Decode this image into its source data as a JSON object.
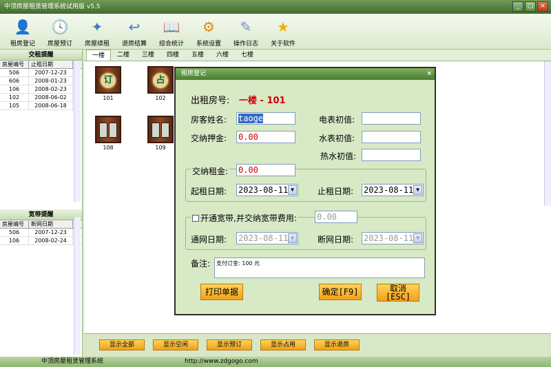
{
  "window": {
    "title": "中顶房屋租赁管理系统试用版 v5.5",
    "min": "_",
    "max": "□",
    "close": "×"
  },
  "toolbar": [
    {
      "label": "租房登记",
      "icon": "id-card-icon",
      "glyph": "👤",
      "color": "#3f7fc8"
    },
    {
      "label": "房屋预订",
      "icon": "calendar-clock-icon",
      "glyph": "🕓",
      "color": "#4a8fcf"
    },
    {
      "label": "房屋续租",
      "icon": "document-star-icon",
      "glyph": "✦",
      "color": "#3b7fbf"
    },
    {
      "label": "退房结算",
      "icon": "return-arrow-icon",
      "glyph": "↩",
      "color": "#3c7fcf"
    },
    {
      "label": "综合统计",
      "icon": "book-icon",
      "glyph": "📖",
      "color": "#d7a437"
    },
    {
      "label": "系统设置",
      "icon": "gear-icon",
      "glyph": "⚙",
      "color": "#e08a10"
    },
    {
      "label": "操作日志",
      "icon": "log-document-icon",
      "glyph": "✎",
      "color": "#6a8fbf"
    },
    {
      "label": "关于软件",
      "icon": "star-icon",
      "glyph": "★",
      "color": "#f0b000"
    }
  ],
  "rentReminder": {
    "title": "交租提醒",
    "col1": "房屋编号",
    "col2": "止租日期",
    "rows": [
      [
        "506",
        "2007-12-23"
      ],
      [
        "606",
        "2008-01-23"
      ],
      [
        "106",
        "2008-02-23"
      ],
      [
        "102",
        "2008-06-02"
      ],
      [
        "105",
        "2008-06-18"
      ]
    ]
  },
  "netReminder": {
    "title": "宽带提醒",
    "col1": "房屋编号",
    "col2": "断网日期",
    "rows": [
      [
        "506",
        "2007-12-23"
      ],
      [
        "106",
        "2008-02-24"
      ]
    ]
  },
  "floors": [
    "一楼",
    "二楼",
    "三楼",
    "四楼",
    "五楼",
    "六楼",
    "七楼"
  ],
  "rooms": [
    {
      "num": "101",
      "badge": "订"
    },
    {
      "num": "102",
      "badge": "占"
    },
    {
      "num": "108",
      "badge": ""
    },
    {
      "num": "109",
      "badge": ""
    }
  ],
  "bottomButtons": [
    "显示全部",
    "显示空闲",
    "显示预订",
    "显示占用",
    "显示退房"
  ],
  "status": {
    "left": "中顶房屋租赁管理系统",
    "url": "http://www.zdgogo.com"
  },
  "dialog": {
    "title": "租房登记",
    "close": "×",
    "roomLabel": "出租房号:",
    "roomValue": "一楼 - 101",
    "tenantLabel": "房客姓名:",
    "tenantValue": "taoge",
    "depositLabel": "交纳押金:",
    "depositValue": "0.00",
    "elecLabel": "电表初值:",
    "elecValue": "",
    "waterLabel": "水表初值:",
    "waterValue": "",
    "hotWaterLabel": "热水初值:",
    "hotWaterValue": "",
    "rentLabel": "交纳租金:",
    "rentValue": "0.00",
    "startLabel": "起租日期:",
    "startValue": "2023-08-11",
    "endLabel": "止租日期:",
    "endValue": "2023-08-11",
    "netCheckLabel": "开通宽带,并交纳宽带费用:",
    "netFeeValue": "0.00",
    "netStartLabel": "通网日期:",
    "netStartValue": "2023-08-11",
    "netEndLabel": "断网日期:",
    "netEndValue": "2023-08-11",
    "remarkLabel": "备注:",
    "remarkValue": "支付订金: 100 元",
    "printBtn": "打印单据",
    "okBtn": "确定[F9]",
    "cancelBtn1": "取消",
    "cancelBtn2": "[ESC]",
    "ddArrow": "▼"
  }
}
